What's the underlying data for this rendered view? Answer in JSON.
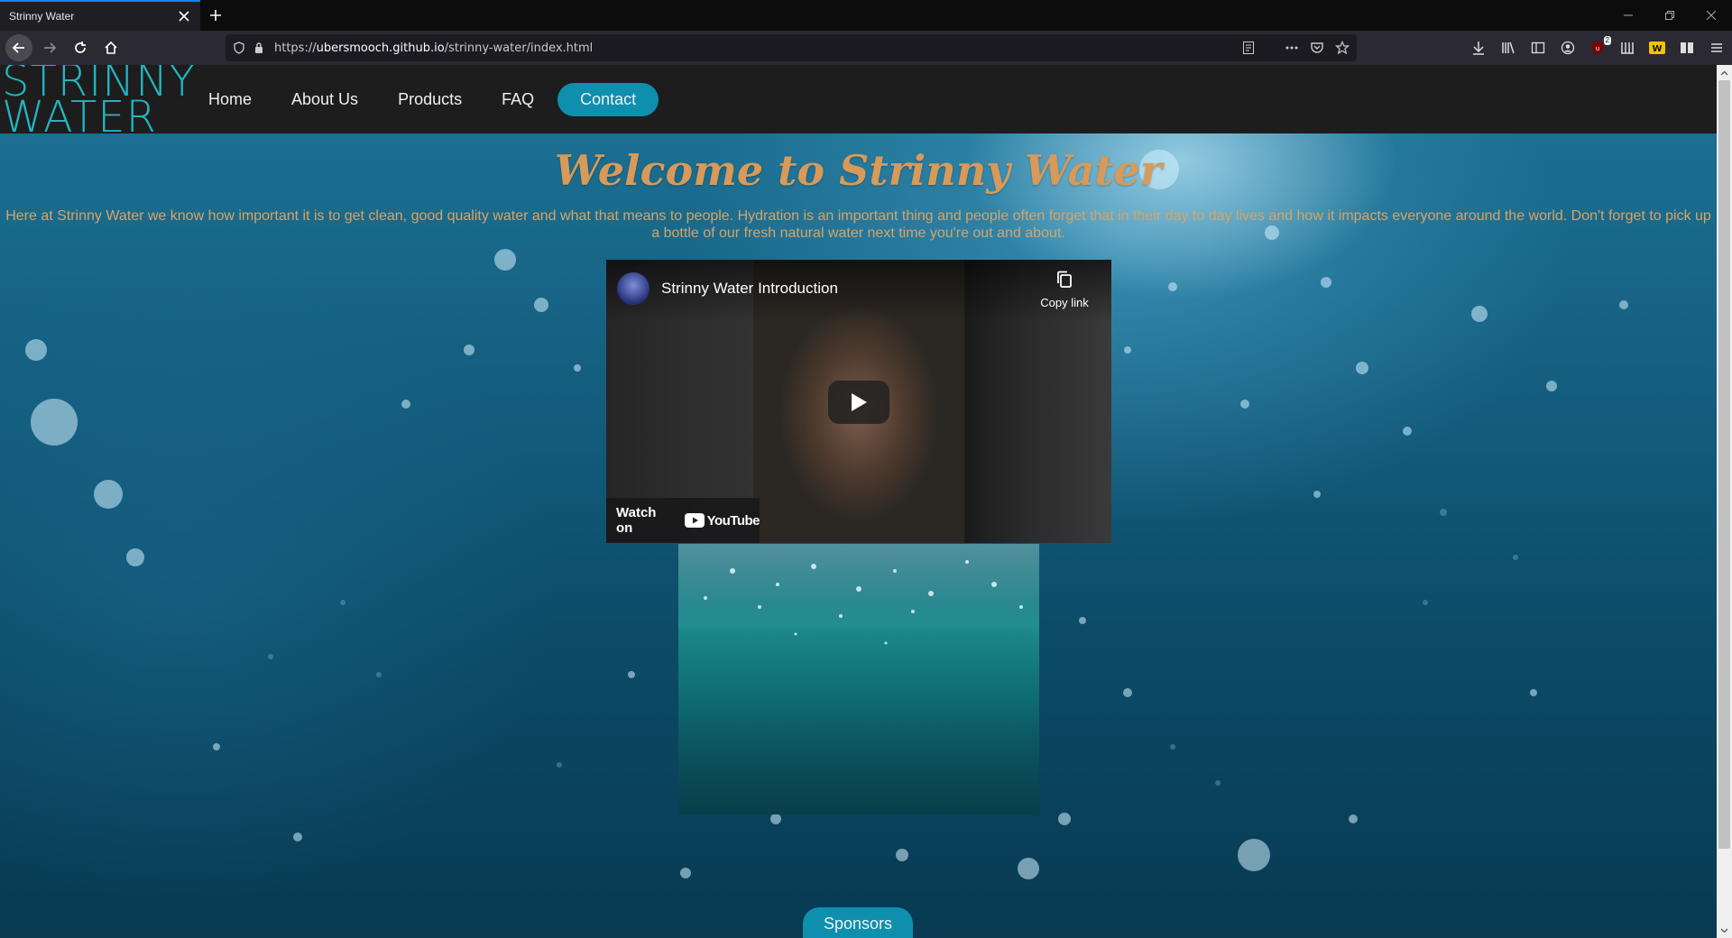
{
  "browser": {
    "tab_title": "Strinny Water",
    "url_prefix": "https://",
    "url_host": "ubersmooch.github.io",
    "url_path": "/strinny-water/index.html",
    "extension_badge": "2"
  },
  "site": {
    "logo_line1": "STRINNY",
    "logo_line2": "WATER",
    "nav": {
      "home": "Home",
      "about": "About Us",
      "products": "Products",
      "faq": "FAQ",
      "contact": "Contact"
    },
    "accent_color": "#0f8fae",
    "heading_color": "#d79a5a"
  },
  "main": {
    "welcome_title": "Welcome to Strinny Water",
    "intro_text": "Here at Strinny Water we know how important it is to get clean, good quality water and what that means to people. Hydration is an important thing and people often forget that in their day to day lives and how it impacts everyone around the world. Don't forget to pick up a bottle of our fresh natural water next time you're out and about.",
    "video": {
      "title": "Strinny Water Introduction",
      "copy_link": "Copy link",
      "watch_on": "Watch on",
      "youtube": "YouTube"
    },
    "sponsors_button": "Sponsors"
  }
}
